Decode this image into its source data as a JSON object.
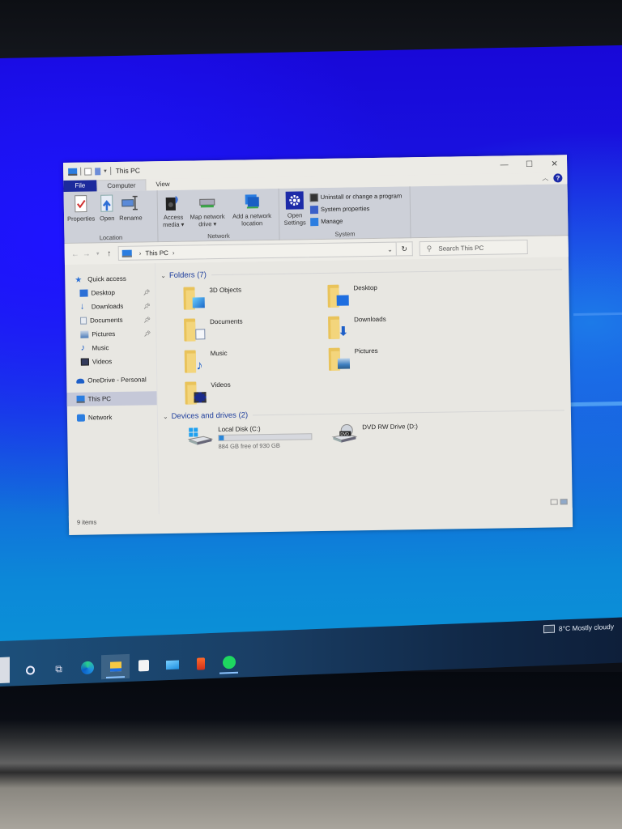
{
  "window": {
    "title": "This PC",
    "controls": {
      "minimize": "—",
      "maximize": "☐",
      "close": "✕"
    }
  },
  "ribbon": {
    "tabs": [
      {
        "label": "File"
      },
      {
        "label": "Computer",
        "active": true
      },
      {
        "label": "View"
      }
    ],
    "groups": {
      "location": {
        "label": "Location",
        "buttons": [
          "Properties",
          "Open",
          "Rename"
        ]
      },
      "network": {
        "label": "Network",
        "buttons": [
          {
            "line1": "Access",
            "line2": "media ▾"
          },
          {
            "line1": "Map network",
            "line2": "drive ▾"
          },
          {
            "line1": "Add a network",
            "line2": "location"
          }
        ]
      },
      "system": {
        "label": "System",
        "open_settings": {
          "line1": "Open",
          "line2": "Settings"
        },
        "items": [
          "Uninstall or change a program",
          "System properties",
          "Manage"
        ]
      }
    },
    "help": "?"
  },
  "address_bar": {
    "path": [
      "This PC"
    ],
    "search_placeholder": "Search This PC"
  },
  "nav_pane": {
    "quick_access": "Quick access",
    "quick_items": [
      {
        "label": "Desktop",
        "pinned": true,
        "icon": "desktop-icon"
      },
      {
        "label": "Downloads",
        "pinned": true,
        "icon": "downloads-icon"
      },
      {
        "label": "Documents",
        "pinned": true,
        "icon": "documents-icon"
      },
      {
        "label": "Pictures",
        "pinned": true,
        "icon": "pictures-icon"
      },
      {
        "label": "Music",
        "pinned": false,
        "icon": "music-icon"
      },
      {
        "label": "Videos",
        "pinned": false,
        "icon": "videos-icon"
      }
    ],
    "onedrive": "OneDrive - Personal",
    "this_pc": "This PC",
    "network": "Network"
  },
  "main": {
    "folders_header": "Folders (7)",
    "folders": [
      {
        "name": "3D Objects",
        "icon": "3d-objects-icon"
      },
      {
        "name": "Desktop",
        "icon": "desktop-icon"
      },
      {
        "name": "Documents",
        "icon": "documents-icon"
      },
      {
        "name": "Downloads",
        "icon": "downloads-icon"
      },
      {
        "name": "Music",
        "icon": "music-icon"
      },
      {
        "name": "Pictures",
        "icon": "pictures-icon"
      },
      {
        "name": "Videos",
        "icon": "videos-icon"
      }
    ],
    "devices_header": "Devices and drives (2)",
    "drives": [
      {
        "name": "Local Disk (C:)",
        "free_text": "884 GB free of 930 GB",
        "used_fraction": 0.05
      },
      {
        "name": "DVD RW Drive (D:)"
      }
    ]
  },
  "status_bar": {
    "items": "9 items"
  },
  "taskbar": {
    "apps": [
      "cortana",
      "task-view",
      "edge",
      "file-explorer",
      "microsoft-store",
      "mail",
      "office",
      "spotify"
    ],
    "weather": "8°C  Mostly cloudy"
  },
  "colors": {
    "accent": "#1c2a9c",
    "folder": "#f3d57c",
    "drive_bar": "#2a86d8"
  }
}
